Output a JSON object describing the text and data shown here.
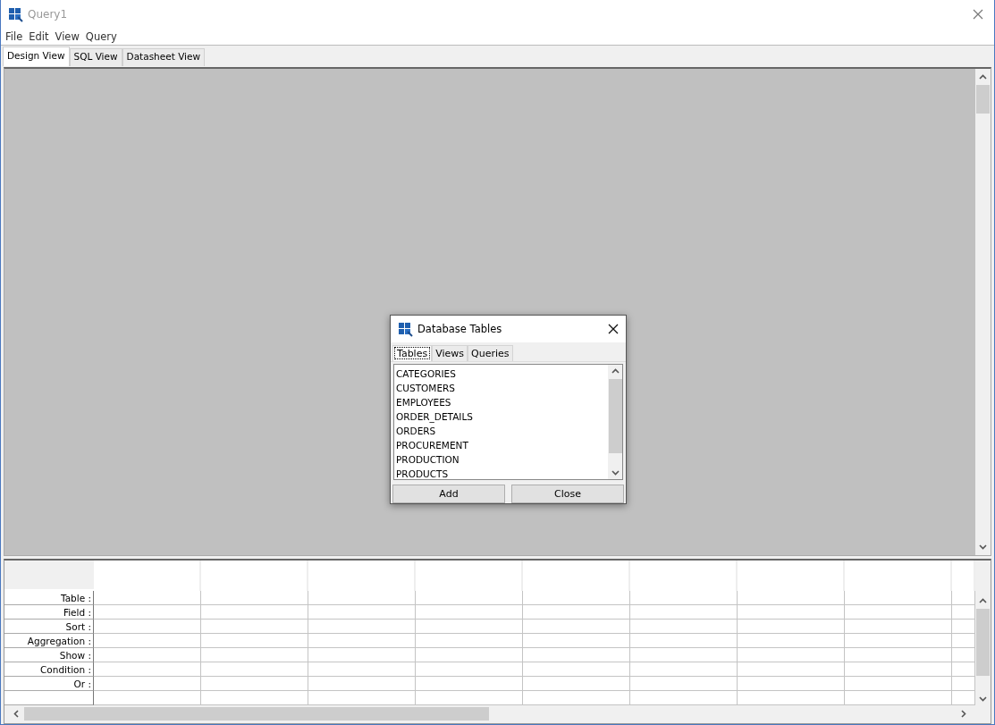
{
  "window": {
    "title": "Query1"
  },
  "menu": [
    "File",
    "Edit",
    "View",
    "Query"
  ],
  "tabs": [
    {
      "label": "Design View",
      "selected": true
    },
    {
      "label": "SQL View",
      "selected": false
    },
    {
      "label": "Datasheet View",
      "selected": false
    }
  ],
  "dialog": {
    "title": "Database Tables",
    "tabs": [
      {
        "label": "Tables",
        "selected": true
      },
      {
        "label": "Views",
        "selected": false
      },
      {
        "label": "Queries",
        "selected": false
      }
    ],
    "items": [
      "CATEGORIES",
      "CUSTOMERS",
      "EMPLOYEES",
      "ORDER_DETAILS",
      "ORDERS",
      "PROCUREMENT",
      "PRODUCTION",
      "PRODUCTS"
    ],
    "buttons": [
      "Add",
      "Close"
    ]
  },
  "grid": {
    "row_labels": [
      "Table :",
      "Field :",
      "Sort :",
      "Aggregation :",
      "Show :",
      "Condition :",
      "Or :"
    ]
  }
}
